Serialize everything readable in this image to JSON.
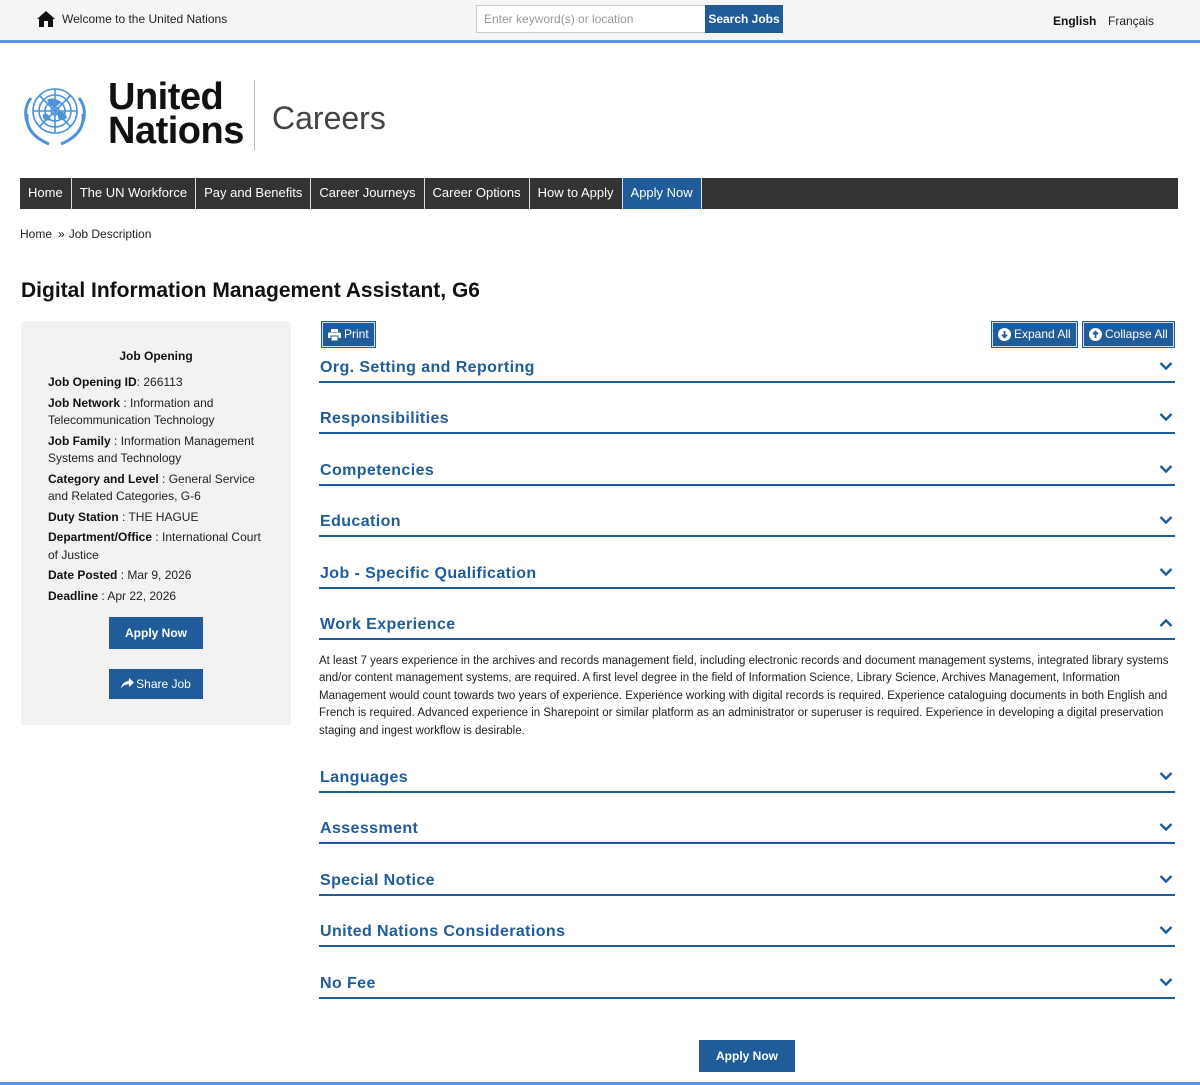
{
  "topbar": {
    "welcome": "Welcome to the United Nations",
    "search_placeholder": "Enter keyword(s) or location",
    "search_button": "Search Jobs",
    "lang_english": "English",
    "lang_french": "Français"
  },
  "header": {
    "logo_line1": "United",
    "logo_line2": "Nations",
    "careers": "Careers"
  },
  "nav": [
    {
      "label": "Home"
    },
    {
      "label": "The UN Workforce"
    },
    {
      "label": "Pay and Benefits"
    },
    {
      "label": "Career Journeys"
    },
    {
      "label": "Career Options"
    },
    {
      "label": "How to Apply"
    },
    {
      "label": "Apply Now"
    }
  ],
  "breadcrumb": {
    "home": "Home",
    "current": "Job Description"
  },
  "page_title": "Digital Information Management Assistant, G6",
  "sidebar": {
    "heading": "Job Opening",
    "fields": [
      {
        "label": "Job Opening ID",
        "sep": ": ",
        "value": "266113"
      },
      {
        "label": "Job Network",
        "sep": " : ",
        "value": "Information and Telecommunication Technology"
      },
      {
        "label": "Job Family",
        "sep": " : ",
        "value": "Information Management Systems and Technology"
      },
      {
        "label": "Category and Level",
        "sep": " : ",
        "value": "General Service and Related Categories, G-6"
      },
      {
        "label": "Duty Station",
        "sep": " : ",
        "value": "THE HAGUE"
      },
      {
        "label": "Department/Office",
        "sep": " : ",
        "value": "International Court of Justice"
      },
      {
        "label": "Date Posted",
        "sep": " : ",
        "value": "Mar 9, 2026"
      },
      {
        "label": "Deadline",
        "sep": " : ",
        "value": "Apr 22, 2026"
      }
    ],
    "apply_button": "Apply Now",
    "share_button": "Share Job"
  },
  "toolbar": {
    "print": "Print",
    "expand_all": "Expand All",
    "collapse_all": "Collapse All"
  },
  "sections": [
    {
      "title": "Org. Setting and Reporting",
      "expanded": false
    },
    {
      "title": "Responsibilities",
      "expanded": false
    },
    {
      "title": "Competencies",
      "expanded": false
    },
    {
      "title": "Education",
      "expanded": false
    },
    {
      "title": "Job - Specific Qualification",
      "expanded": false
    },
    {
      "title": "Work Experience",
      "expanded": true,
      "body": "At least 7 years experience in the archives and records management field, including electronic records and document management systems, integrated library systems and/or content management systems, are required. A first level degree in the field of Information Science, Library Science, Archives Management, Information Management would count towards two years of experience.    Experience working with digital records is required.    Experience cataloguing documents in both English and French is required.    Advanced experience in Sharepoint or similar platform as an administrator or superuser is required.    Experience in developing a digital preservation staging and ingest workflow is desirable."
    },
    {
      "title": "Languages",
      "expanded": false
    },
    {
      "title": "Assessment",
      "expanded": false
    },
    {
      "title": "Special Notice",
      "expanded": false
    },
    {
      "title": "United Nations Considerations",
      "expanded": false
    },
    {
      "title": "No Fee",
      "expanded": false
    }
  ],
  "bottom_apply": "Apply Now",
  "colors": {
    "primary": "#1f5c99",
    "accent_line": "#5b92e5",
    "nav_bg": "#333333"
  }
}
